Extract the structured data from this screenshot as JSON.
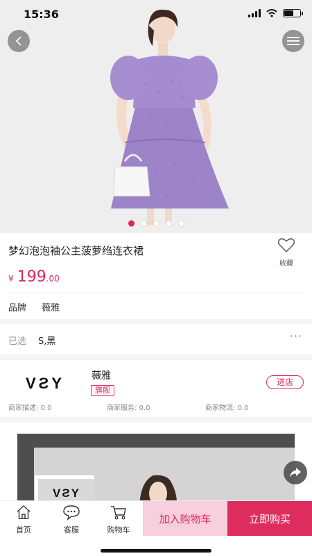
{
  "status": {
    "time": "15:36"
  },
  "product": {
    "title": "梦幻泡泡袖公主菠萝绉连衣裙",
    "fav_label": "收藏",
    "price_symbol": "¥",
    "price_int": "199",
    "price_dec": ".00",
    "brand_label": "品牌",
    "brand_value": "薇雅",
    "image_dots": 5,
    "active_dot": 0
  },
  "selection": {
    "label": "已选",
    "value": "S,黑",
    "more": "···"
  },
  "store": {
    "logo_text": "VƧY",
    "name": "薇雅",
    "badge": "旗舰",
    "enter_label": "进店",
    "ratings": [
      {
        "label": "商家描述:",
        "value": "0.0"
      },
      {
        "label": "商家服务:",
        "value": "0.0"
      },
      {
        "label": "商家物流:",
        "value": "0.0"
      }
    ]
  },
  "detail": {
    "card_logo_text": "VƧY"
  },
  "bottom_bar": {
    "tabs": [
      {
        "label": "首页",
        "icon": "home-icon"
      },
      {
        "label": "客服",
        "icon": "chat-icon"
      },
      {
        "label": "购物车",
        "icon": "cart-icon"
      }
    ],
    "add_to_cart": "加入购物车",
    "buy_now": "立即购买"
  },
  "colors": {
    "accent": "#e0245e",
    "cart_bg": "#f8cfdc",
    "dress": "#9d83c7"
  }
}
